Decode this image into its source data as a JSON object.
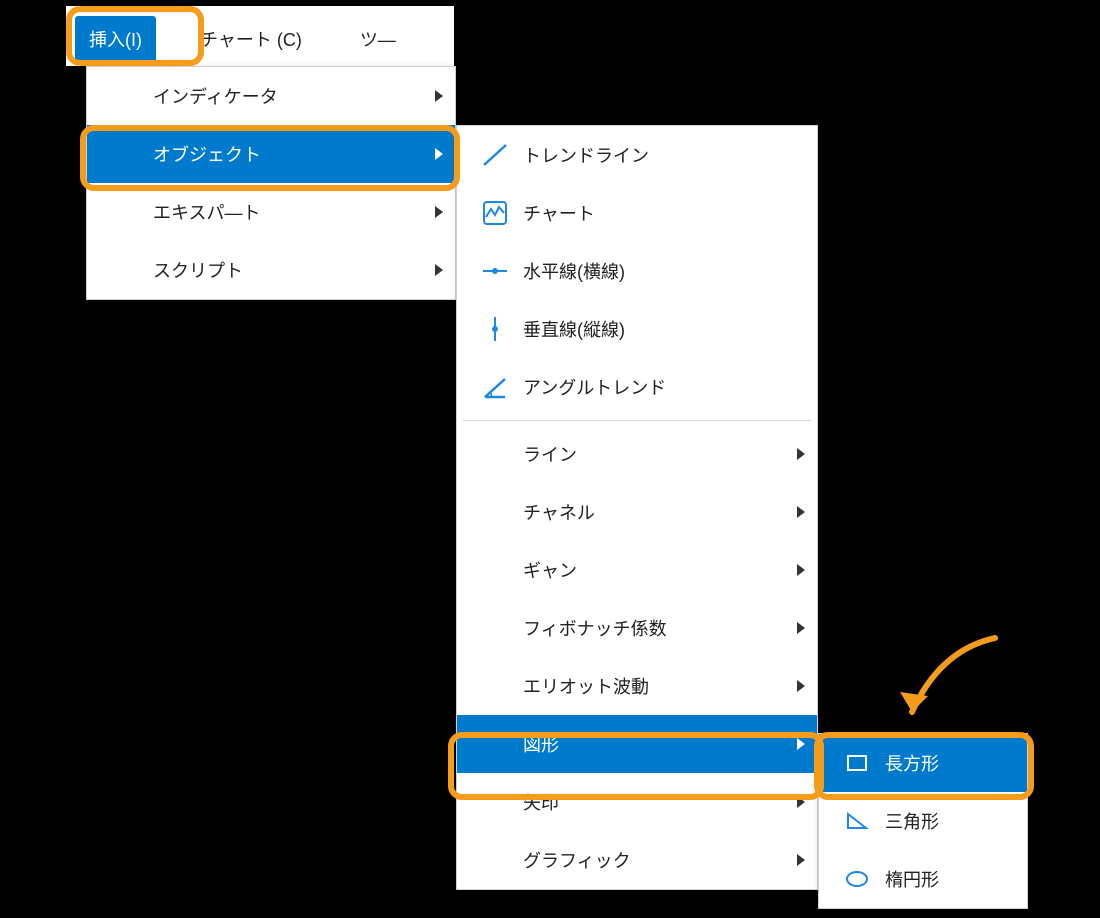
{
  "menubar": {
    "insert": "挿入(I)",
    "chart": "チャート (C)",
    "tools_fragment": "ツ―"
  },
  "dropdown1": {
    "indicators": "インディケータ",
    "objects": "オブジェクト",
    "experts": "エキスパ―ト",
    "scripts": "スクリプト"
  },
  "dropdown2": {
    "trendline": "トレンドライン",
    "chart": "チャート",
    "horizontal": "水平線(横線)",
    "vertical": "垂直線(縦線)",
    "angle_trend": "アングルトレンド",
    "line": "ライン",
    "channel": "チャネル",
    "gann": "ギャン",
    "fibonacci": "フィボナッチ係数",
    "elliott": "エリオット波動",
    "shapes": "図形",
    "arrows": "矢印",
    "graphics": "グラフィック"
  },
  "dropdown3": {
    "rectangle": "長方形",
    "triangle": "三角形",
    "ellipse": "楕円形"
  },
  "colors": {
    "highlight": "#007ACC",
    "ring": "#F59C1A",
    "icon_blue": "#1E88E5"
  }
}
